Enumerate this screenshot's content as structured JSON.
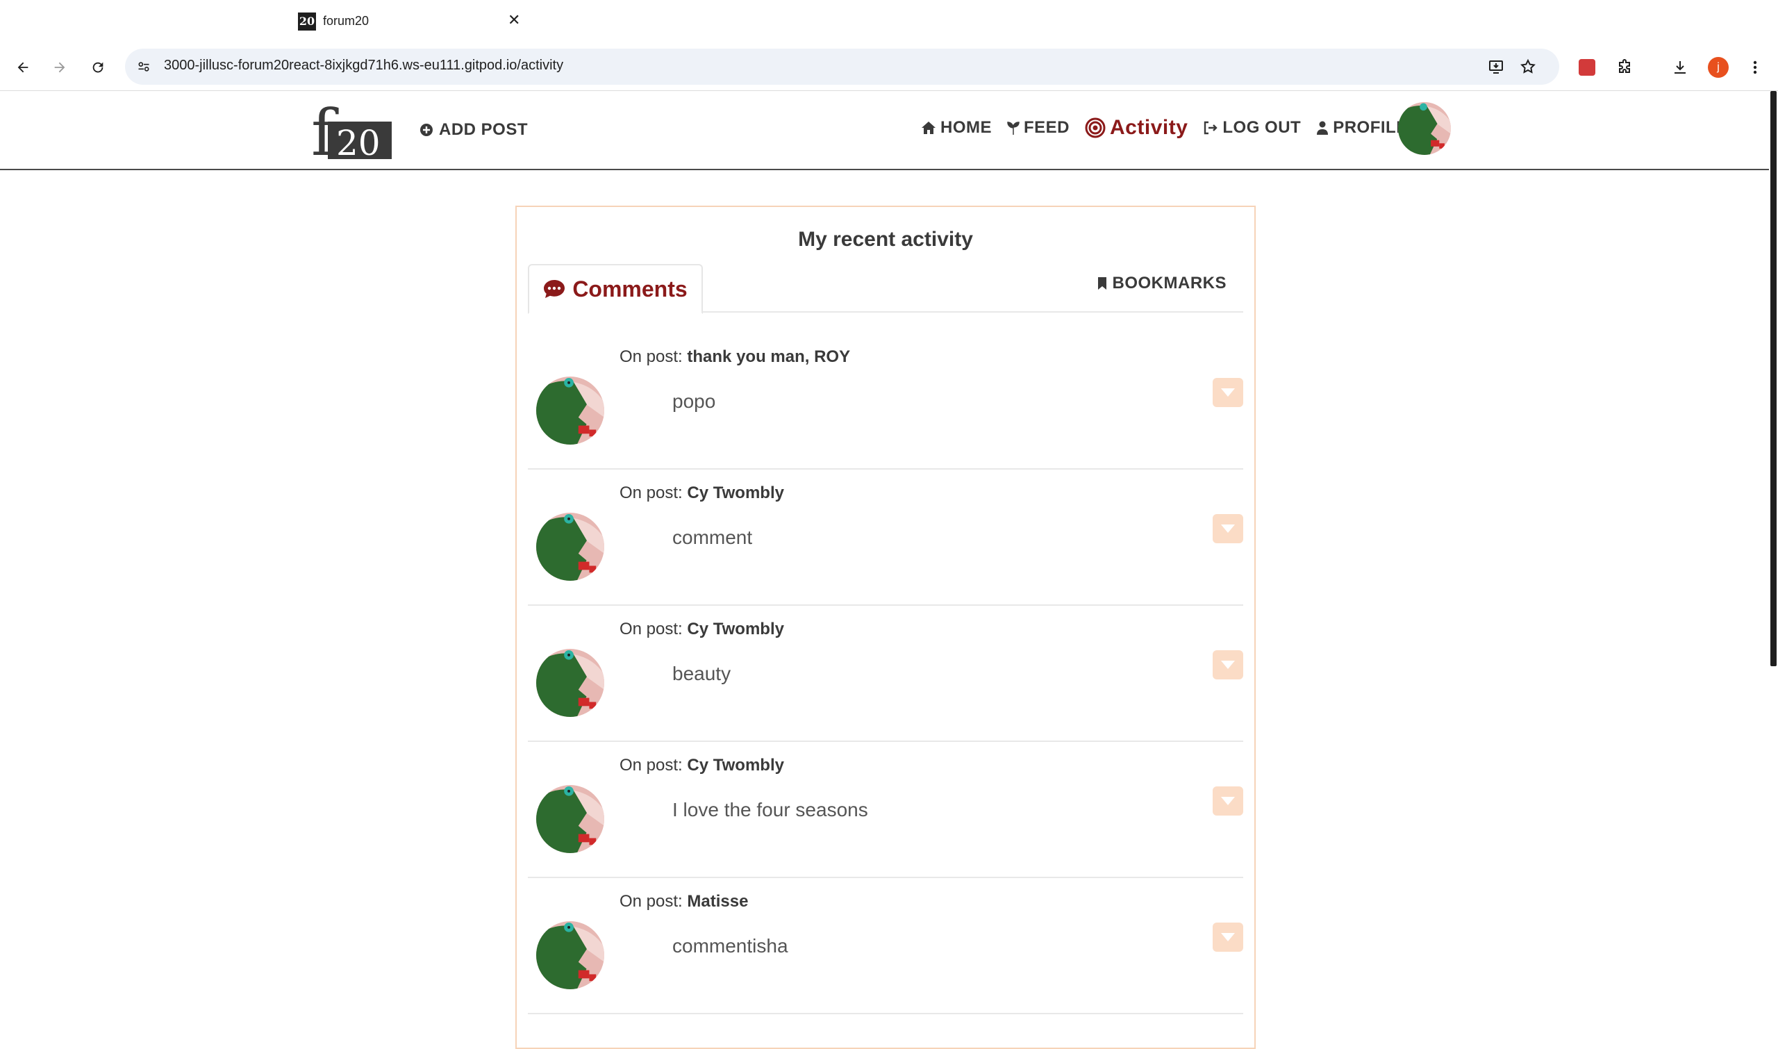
{
  "browser": {
    "tab_title": "forum20",
    "tab_favicon_text": "20",
    "url": "3000-jillusc-forum20react-8ixjkgd71h6.ws-eu111.gitpod.io/activity",
    "profile_initial": "j"
  },
  "site": {
    "logo_text": "f20",
    "add_post_label": "ADD POST",
    "nav": {
      "home": "HOME",
      "feed": "FEED",
      "activity": "Activity",
      "logout": "LOG OUT",
      "profile": "PROFILE"
    }
  },
  "activity": {
    "title": "My recent activity",
    "tab_comments": "Comments",
    "tab_bookmarks": "BOOKMARKS",
    "comment_prefix": "On post:",
    "comments": [
      {
        "post": "thank you man, ROY",
        "text": "popo"
      },
      {
        "post": "Cy Twombly",
        "text": "comment"
      },
      {
        "post": "Cy Twombly",
        "text": "beauty"
      },
      {
        "post": "Cy Twombly",
        "text": "I love the four seasons"
      },
      {
        "post": "Matisse",
        "text": "commentisha"
      }
    ]
  },
  "colors": {
    "accent": "#8b1a1a",
    "card_border": "#f6d3b8",
    "menu_button": "#fbdcc6",
    "avatar_green": "#2d6b2f"
  }
}
